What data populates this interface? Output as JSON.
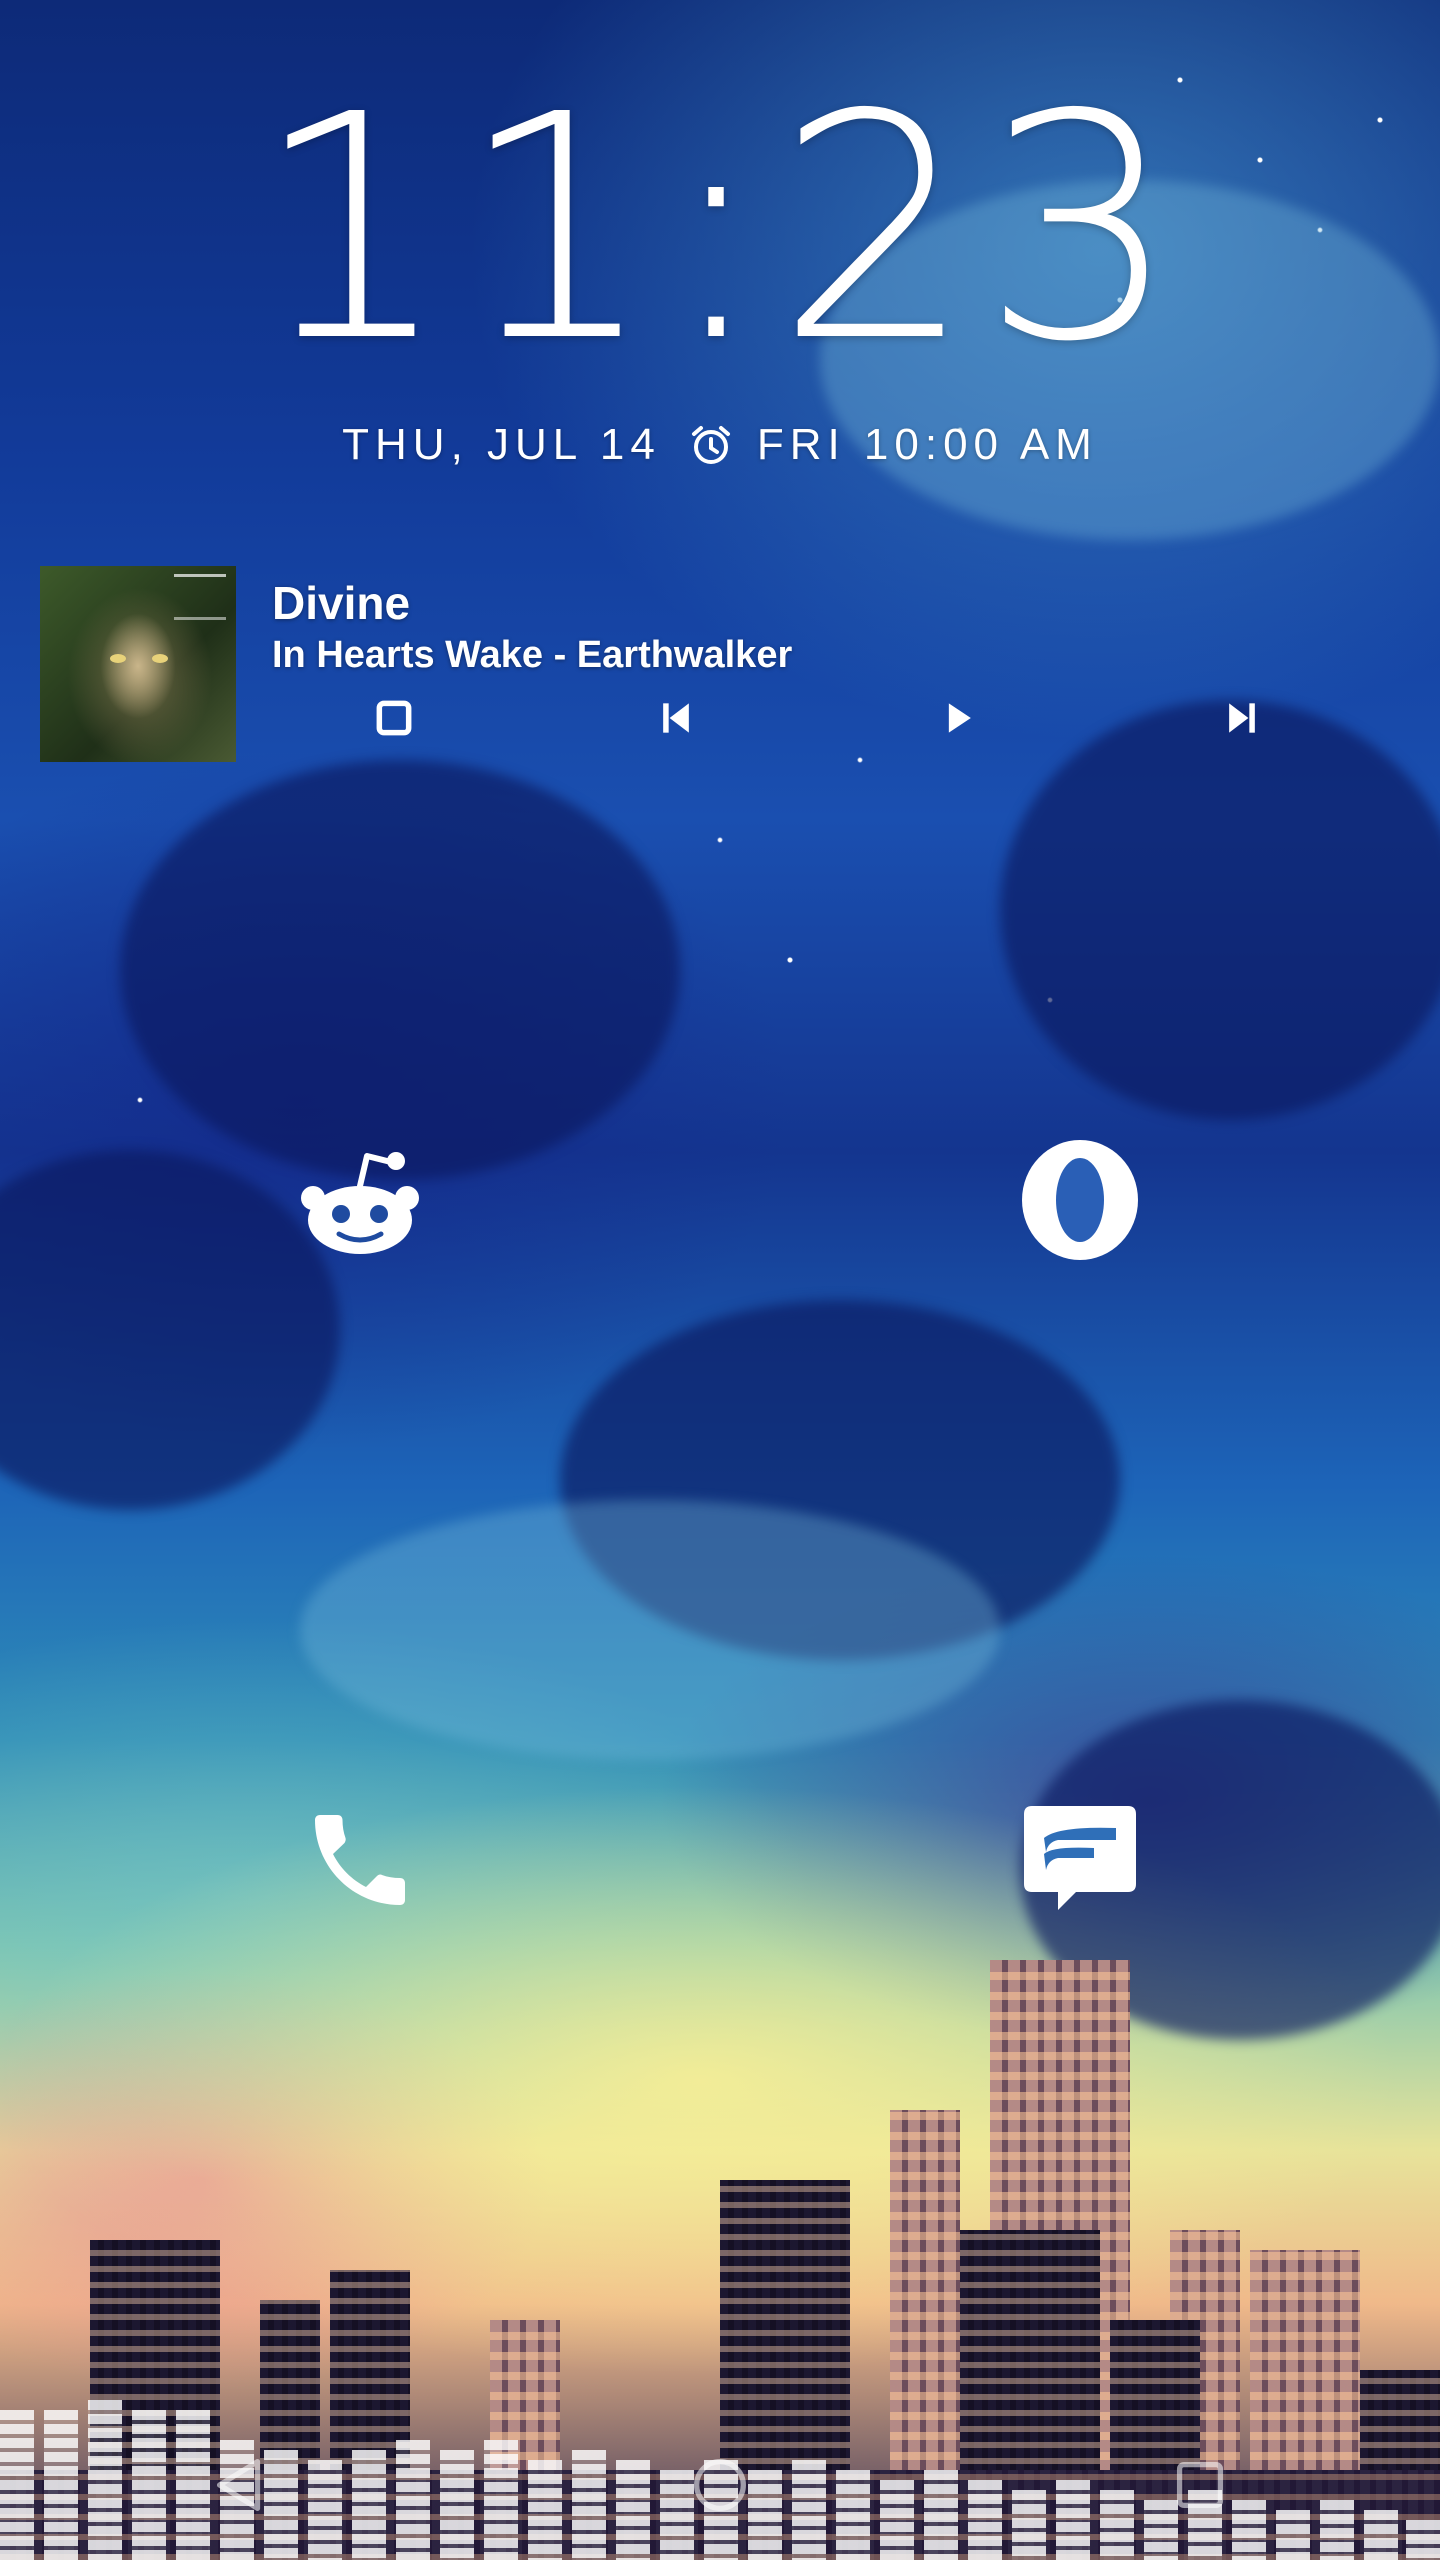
{
  "lockscreen": {
    "time": "11:23",
    "date": "THU, JUL 14",
    "next_alarm": "FRI 10:00 AM",
    "alarm_icon": "alarm-clock-icon"
  },
  "media": {
    "title": "Divine",
    "artist_album": "In Hearts Wake - Earthwalker",
    "album_art": "album-cover-earthwalker",
    "controls": [
      {
        "name": "stop",
        "icon": "stop-icon"
      },
      {
        "name": "previous",
        "icon": "skip-previous-icon"
      },
      {
        "name": "play",
        "icon": "play-icon"
      },
      {
        "name": "next",
        "icon": "skip-next-icon"
      }
    ]
  },
  "shortcuts": [
    {
      "app": "reddit",
      "icon": "reddit-icon"
    },
    {
      "app": "opera",
      "icon": "opera-icon"
    },
    {
      "app": "phone",
      "icon": "phone-icon"
    },
    {
      "app": "messaging",
      "icon": "message-icon"
    }
  ],
  "navigation": [
    {
      "name": "back",
      "icon": "back-triangle-icon"
    },
    {
      "name": "home",
      "icon": "home-circle-icon"
    },
    {
      "name": "recents",
      "icon": "recents-square-icon"
    }
  ],
  "colors": {
    "text": "#ffffff",
    "sky_top": "#0d2a78",
    "sky_glow": "#e7e39a"
  }
}
